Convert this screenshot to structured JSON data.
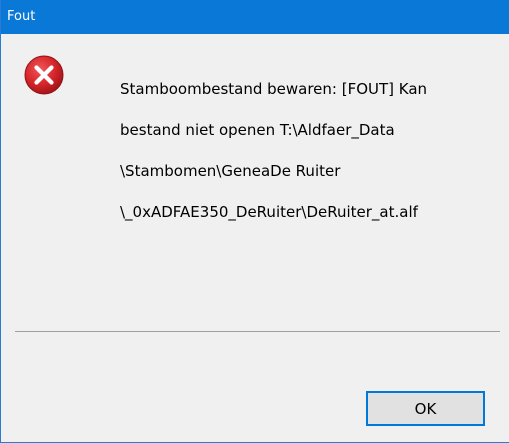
{
  "window": {
    "title": "Fout"
  },
  "dialog": {
    "icon": "error-icon",
    "message_lines": [
      "Stamboombestand bewaren: [FOUT] Kan",
      "bestand niet openen T:\\Aldfaer_Data",
      "\\Stambomen\\GeneaDe Ruiter",
      "\\_0xADFAE350_DeRuiter\\DeRuiter_at.alf"
    ],
    "ok_label": "OK"
  },
  "colors": {
    "titlebar": "#0a78d7",
    "accent": "#0078d7",
    "error_red": "#d7262b"
  }
}
